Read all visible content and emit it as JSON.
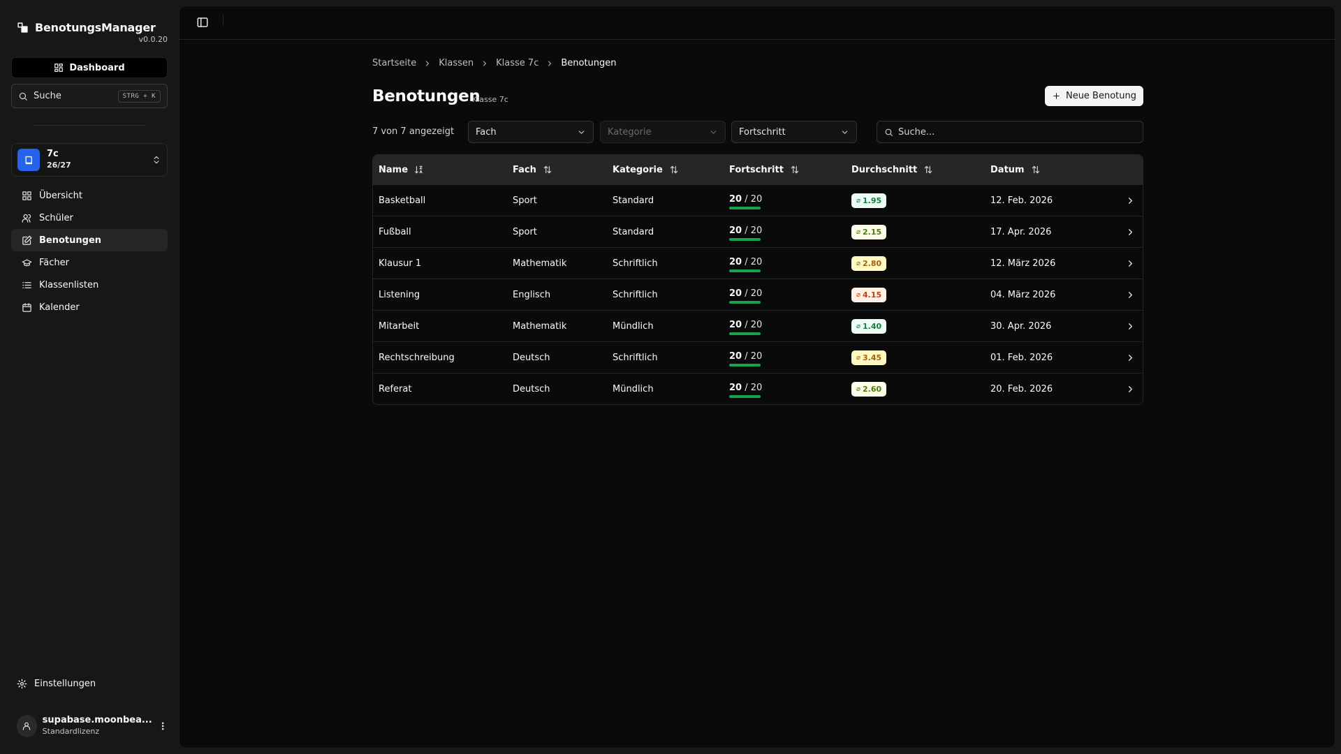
{
  "app": {
    "name": "BenotungsManager",
    "version": "v0.0.20",
    "dashboard_label": "Dashboard",
    "search_label": "Suche",
    "search_shortcut": "STRG + K"
  },
  "class_switcher": {
    "name": "7c",
    "count": "26/27"
  },
  "nav": {
    "items": [
      {
        "label": "Übersicht",
        "icon": "grid-icon"
      },
      {
        "label": "Schüler",
        "icon": "users-icon"
      },
      {
        "label": "Benotungen",
        "icon": "edit-icon",
        "active": true
      },
      {
        "label": "Fächer",
        "icon": "graduation-cap-icon"
      },
      {
        "label": "Klassenlisten",
        "icon": "list-icon"
      },
      {
        "label": "Kalender",
        "icon": "calendar-icon"
      }
    ]
  },
  "footer": {
    "settings_label": "Einstellungen",
    "user_name": "supabase.moonbea...",
    "user_plan": "Standardlizenz"
  },
  "breadcrumb": [
    "Startseite",
    "Klassen",
    "Klasse 7c",
    "Benotungen"
  ],
  "page": {
    "title": "Benotungen",
    "subtitle": "Klasse 7c",
    "new_button": "Neue Benotung",
    "count_text": "7 von 7 angezeigt"
  },
  "filters": {
    "fach": "Fach",
    "kategorie": "Kategorie",
    "fortschritt": "Fortschritt",
    "search_placeholder": "Suche..."
  },
  "table": {
    "columns": [
      "Name",
      "Fach",
      "Kategorie",
      "Fortschritt",
      "Durchschnitt",
      "Datum"
    ],
    "rows": [
      {
        "name": "Basketball",
        "fach": "Sport",
        "kategorie": "Standard",
        "done": "20",
        "total": "/ 20",
        "avg": "1.95",
        "date": "12. Feb. 2026"
      },
      {
        "name": "Fußball",
        "fach": "Sport",
        "kategorie": "Standard",
        "done": "20",
        "total": "/ 20",
        "avg": "2.15",
        "date": "17. Apr. 2026"
      },
      {
        "name": "Klausur 1",
        "fach": "Mathematik",
        "kategorie": "Schriftlich",
        "done": "20",
        "total": "/ 20",
        "avg": "2.80",
        "date": "12. März 2026"
      },
      {
        "name": "Listening",
        "fach": "Englisch",
        "kategorie": "Schriftlich",
        "done": "20",
        "total": "/ 20",
        "avg": "4.15",
        "date": "04. März 2026"
      },
      {
        "name": "Mitarbeit",
        "fach": "Mathematik",
        "kategorie": "Mündlich",
        "done": "20",
        "total": "/ 20",
        "avg": "1.40",
        "date": "30. Apr. 2026"
      },
      {
        "name": "Rechtschreibung",
        "fach": "Deutsch",
        "kategorie": "Schriftlich",
        "done": "20",
        "total": "/ 20",
        "avg": "3.45",
        "date": "01. Feb. 2026"
      },
      {
        "name": "Referat",
        "fach": "Deutsch",
        "kategorie": "Mündlich",
        "done": "20",
        "total": "/ 20",
        "avg": "2.60",
        "date": "20. Feb. 2026"
      }
    ]
  },
  "colors": {
    "accent_blue": "#2563eb",
    "progress_green": "#16a34a",
    "grade_good_bg": "#ecfdf5",
    "grade_good_fg": "#15803d",
    "grade_ok_bg": "#fefce8",
    "grade_ok_fg": "#4d7c0f",
    "grade_mid_bg": "#fef9c3",
    "grade_mid_fg": "#a16207",
    "grade_bad_bg": "#fff1e6",
    "grade_bad_fg": "#c2410c"
  }
}
